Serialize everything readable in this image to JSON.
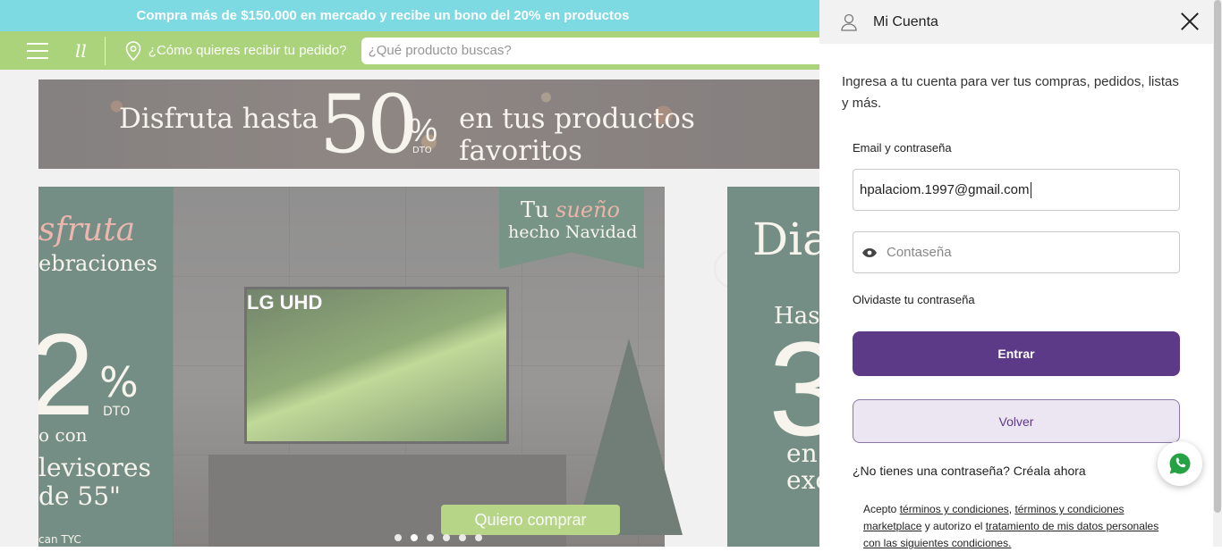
{
  "promo_bar": {
    "text": "Compra más de $150.000 en mercado y recibe un bono del 20% en productos"
  },
  "nav": {
    "logo_text": "ll",
    "location_text": "¿Cómo quieres recibir tu pedido?",
    "search_placeholder": "¿Qué producto buscas?"
  },
  "banner": {
    "text_before": "Disfruta hasta",
    "percent": "50",
    "percent_sign": "%",
    "dto": "DTO",
    "text_after": "en tus productos favoritos"
  },
  "hero": {
    "left": {
      "title": "sfruta",
      "subtitle": "ebraciones",
      "number": "2",
      "percent_sign": "%",
      "dto": "DTO",
      "line1": "o con",
      "line2": "levisores",
      "line3": "de 55\"",
      "line4": "can TYC"
    },
    "tv_brand": "LG UHD",
    "tag_line1_a": "Tu",
    "tag_line1_b": "sueño",
    "tag_line2": "hecho Navidad",
    "cta": "Quiero comprar",
    "right": {
      "title": "Dia",
      "line1": "Hast",
      "number": "3",
      "line2": "en",
      "line3": "exc"
    },
    "carousel_count": 6,
    "carousel_active": 2
  },
  "drawer": {
    "title": "Mi Cuenta",
    "intro": "Ingresa a tu cuenta para ver tus compras, pedidos, listas y más.",
    "email_label": "Email y contraseña",
    "email_value": "hpalaciom.1997@gmail.com",
    "password_placeholder": "Contaseña",
    "forgot": "Olvidaste tu contraseña",
    "submit": "Entrar",
    "back": "Volver",
    "signup_question": "¿No tienes una contraseña?",
    "signup_link": "Créala ahora",
    "terms_prefix": "Acepto",
    "terms_link1": "términos y condiciones",
    "terms_sep": ",",
    "terms_link2": "términos y condiciones marketplace",
    "terms_mid": "y autorizo el",
    "terms_link3": "tratamiento de mis datos personales con las siguientes condiciones."
  },
  "colors": {
    "promo": "#2ec2d1",
    "nav": "#76b82a",
    "primary_button": "#5c3a87",
    "secondary_button": "#ebe6f1"
  },
  "icons": [
    "menu-icon",
    "location-pin-icon",
    "user-icon",
    "close-icon",
    "eye-icon",
    "whatsapp-icon"
  ]
}
